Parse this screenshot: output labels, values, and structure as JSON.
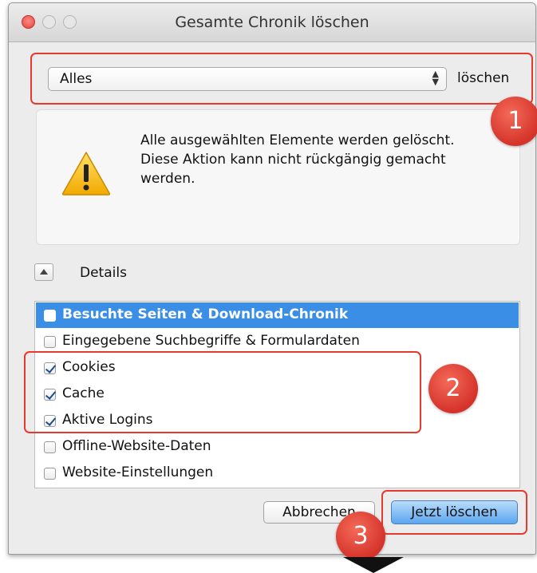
{
  "window": {
    "title": "Gesamte Chronik löschen"
  },
  "range": {
    "selected": "Alles",
    "arrows_icon": "up-down-arrows-icon",
    "suffix_label": "löschen"
  },
  "warning": {
    "icon": "warning-triangle-icon",
    "line1": "Alle ausgewählten Elemente werden gelöscht.",
    "line2": "Diese Aktion kann nicht rückgängig gemacht werden."
  },
  "details": {
    "toggle_icon": "disclosure-up-icon",
    "label": "Details"
  },
  "items": [
    {
      "label": "Besuchte Seiten & Download-Chronik",
      "checked": false,
      "selected": true
    },
    {
      "label": "Eingegebene Suchbegriffe & Formulardaten",
      "checked": false,
      "selected": false
    },
    {
      "label": "Cookies",
      "checked": true,
      "selected": false
    },
    {
      "label": "Cache",
      "checked": true,
      "selected": false
    },
    {
      "label": "Aktive Logins",
      "checked": true,
      "selected": false
    },
    {
      "label": "Offline-Website-Daten",
      "checked": false,
      "selected": false
    },
    {
      "label": "Website-Einstellungen",
      "checked": false,
      "selected": false
    }
  ],
  "buttons": {
    "cancel": "Abbrechen",
    "confirm": "Jetzt löschen"
  },
  "annotations": {
    "badge1": "1",
    "badge2": "2",
    "badge3": "3",
    "color": "#e8392f"
  },
  "colors": {
    "selection": "#3a8ee6",
    "primary_button": "#5aa6ee",
    "warning": "#f2b705"
  }
}
